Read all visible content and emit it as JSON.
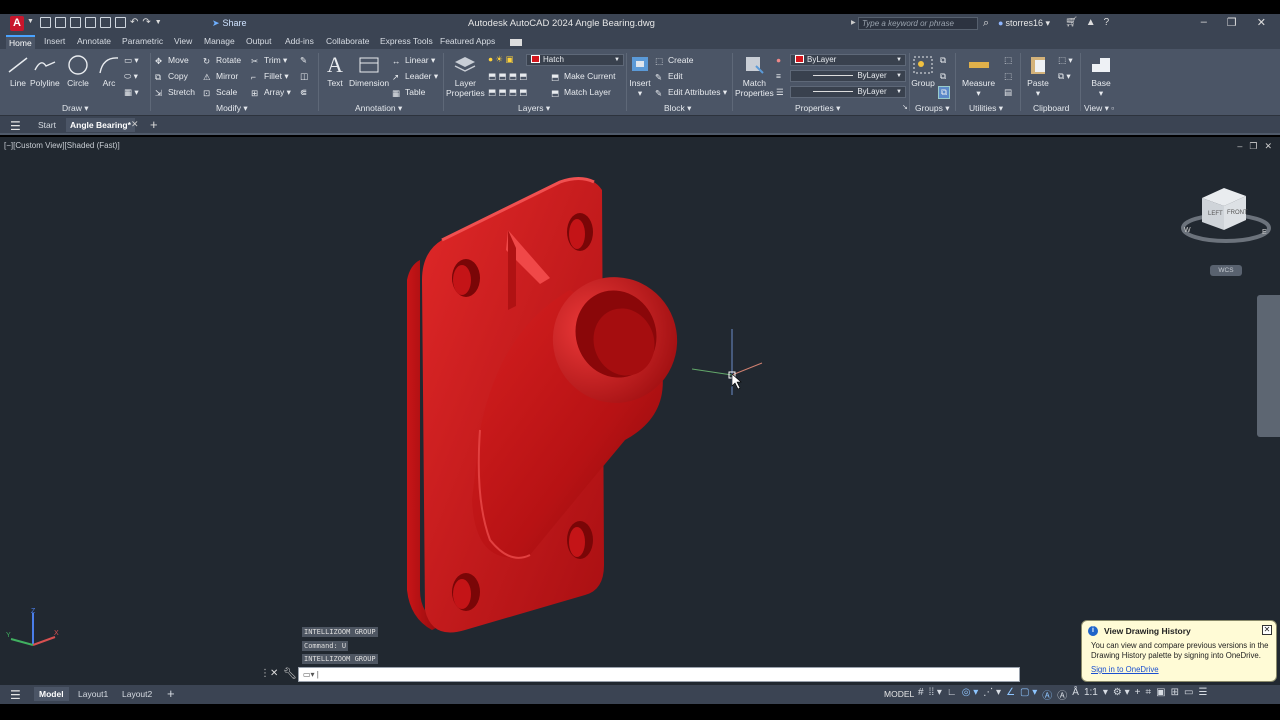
{
  "window": {
    "app_badge": "A",
    "title": "Autodesk AutoCAD 2024   Angle Bearing.dwg",
    "share": "Share",
    "search_placeholder": "Type a keyword or phrase",
    "user": "storres16"
  },
  "ribbon_tabs": [
    "Home",
    "Insert",
    "Annotate",
    "Parametric",
    "View",
    "Manage",
    "Output",
    "Add-ins",
    "Collaborate",
    "Express Tools",
    "Featured Apps"
  ],
  "ribbon": {
    "draw": {
      "title": "Draw",
      "line": "Line",
      "polyline": "Polyline",
      "circle": "Circle",
      "arc": "Arc"
    },
    "modify": {
      "title": "Modify",
      "move": "Move",
      "rotate": "Rotate",
      "trim": "Trim",
      "copy": "Copy",
      "mirror": "Mirror",
      "fillet": "Fillet",
      "stretch": "Stretch",
      "scale": "Scale",
      "array": "Array"
    },
    "annotation": {
      "title": "Annotation",
      "text": "Text",
      "dimension": "Dimension",
      "linear": "Linear",
      "leader": "Leader",
      "table": "Table"
    },
    "layers": {
      "title": "Layers",
      "layer_properties": "Layer\nProperties",
      "layer_value": "Hatch",
      "make_current": "Make Current",
      "match_layer": "Match Layer"
    },
    "block": {
      "title": "Block",
      "insert": "Insert",
      "create": "Create",
      "edit": "Edit",
      "edit_attributes": "Edit Attributes"
    },
    "properties": {
      "title": "Properties",
      "match": "Match\nProperties",
      "color": "ByLayer",
      "linetype": "ByLayer",
      "lineweight": "ByLayer"
    },
    "groups": {
      "title": "Groups",
      "group": "Group"
    },
    "utilities": {
      "title": "Utilities",
      "measure": "Measure"
    },
    "clipboard": {
      "title": "Clipboard",
      "paste": "Paste"
    },
    "view": {
      "title": "View",
      "base": "Base"
    }
  },
  "doc_tabs": {
    "start": "Start",
    "active": "Angle Bearing*"
  },
  "viewport": {
    "label": "[−][Custom View][Shaded (Fast)]",
    "viewcube_left": "LEFT",
    "viewcube_front": "FRONT",
    "wcs": "WCS",
    "model_color": "#c9151a"
  },
  "command_history": [
    "INTELLIZOOM GROUP",
    "Command: U",
    "INTELLIZOOM GROUP"
  ],
  "command_input": "",
  "notification": {
    "title": "View Drawing History",
    "body": "You can view and compare previous versions in the Drawing History palette by signing into OneDrive.",
    "link": "Sign in to OneDrive"
  },
  "status": {
    "tabs": [
      "Model",
      "Layout1",
      "Layout2"
    ],
    "model_button": "MODEL",
    "scale": "1:1"
  }
}
